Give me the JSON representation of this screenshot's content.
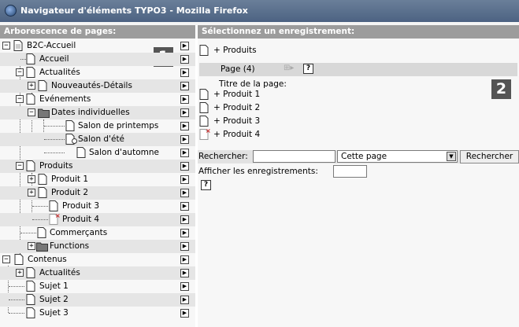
{
  "window": {
    "title": "Navigateur d'éléments TYPO3 - Mozilla Firefox"
  },
  "left": {
    "header": "Arborescence de pages:",
    "badge": "1",
    "items": [
      {
        "label": "B2C-Accueil"
      },
      {
        "label": "Accueil"
      },
      {
        "label": "Actualités"
      },
      {
        "label": "Nouveautés-Détails"
      },
      {
        "label": "Evénements"
      },
      {
        "label": "Dates individuelles"
      },
      {
        "label": "Salon de printemps"
      },
      {
        "label": "Salon d'été"
      },
      {
        "label": "Salon d'automne"
      },
      {
        "label": "Produits"
      },
      {
        "label": "Produit 1"
      },
      {
        "label": "Produit 2"
      },
      {
        "label": "Produit 3"
      },
      {
        "label": "Produit 4"
      },
      {
        "label": "Commerçants"
      },
      {
        "label": "Functions"
      },
      {
        "label": "Contenus"
      },
      {
        "label": "Actualités"
      },
      {
        "label": "Sujet 1"
      },
      {
        "label": "Sujet 2"
      },
      {
        "label": "Sujet 3"
      }
    ]
  },
  "right": {
    "header": "Sélectionnez un enregistrement:",
    "current_page": "+ Produits",
    "badge": "2",
    "page_bar": "Page (4)",
    "title_label": "Titre de la page:",
    "records": [
      {
        "label": "+ Produit 1"
      },
      {
        "label": "+ Produit 2"
      },
      {
        "label": "+ Produit 3"
      },
      {
        "label": "+ Produit 4"
      }
    ],
    "search": {
      "label": "Rechercher:",
      "value": "",
      "scope_selected": "Cette page",
      "button": "Rechercher"
    },
    "show_records_label": "Afficher les enregistrements:",
    "show_records_value": ""
  },
  "colors": {
    "titlebar": "#4c6282",
    "header": "#9c9c9c",
    "badge": "#555555"
  }
}
